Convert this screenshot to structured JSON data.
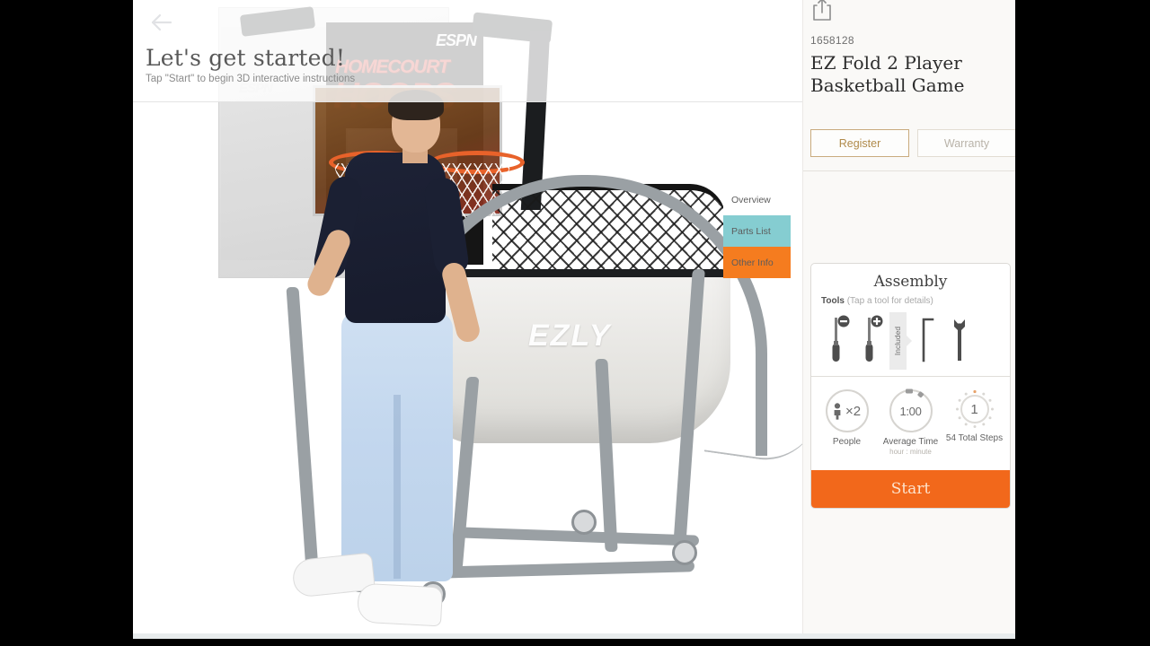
{
  "overlay": {
    "back_icon": "back-arrow-icon",
    "title": "Let's get started!",
    "subtitle": "Tap \"Start\" to begin 3D interactive instructions"
  },
  "tabs": [
    {
      "label": "Overview",
      "color": "#ffffff",
      "active": true
    },
    {
      "label": "Parts List",
      "color": "#85cdd1",
      "active": false
    },
    {
      "label": "Other Info",
      "color": "#f57c1f",
      "active": false
    }
  ],
  "product": {
    "share_icon": "share-icon",
    "sku": "1658128",
    "title": "EZ Fold 2 Player Basketball Game",
    "register_label": "Register",
    "warranty_label": "Warranty"
  },
  "assembly": {
    "title": "Assembly",
    "tools_label": "Tools",
    "tools_hint": "(Tap a tool for details)",
    "included_label": "Included",
    "tools": [
      {
        "name": "flathead-screwdriver-icon"
      },
      {
        "name": "phillips-screwdriver-icon"
      },
      {
        "name": "allen-key-icon"
      },
      {
        "name": "wrench-icon"
      }
    ],
    "stats": [
      {
        "icon": "people-icon",
        "value": "×2",
        "label": "People",
        "sub": ""
      },
      {
        "icon": "stopwatch-icon",
        "value": "1:00",
        "label": "Average Time",
        "sub": "hour : minute"
      },
      {
        "icon": "step-dial-icon",
        "value": "1",
        "label": "54 Total Steps",
        "sub": ""
      }
    ],
    "start_label": "Start"
  },
  "colors": {
    "accent_orange": "#f2681b",
    "tab_teal": "#85cdd1",
    "tab_orange": "#f57c1f",
    "register_gold": "#b08a4a",
    "panel_bg": "#faf9f7"
  },
  "product_art": {
    "brand": "ESPN",
    "box_line1": "HOMECOURT",
    "box_line2": "HOOPS",
    "trough_logo": "EZLY"
  }
}
